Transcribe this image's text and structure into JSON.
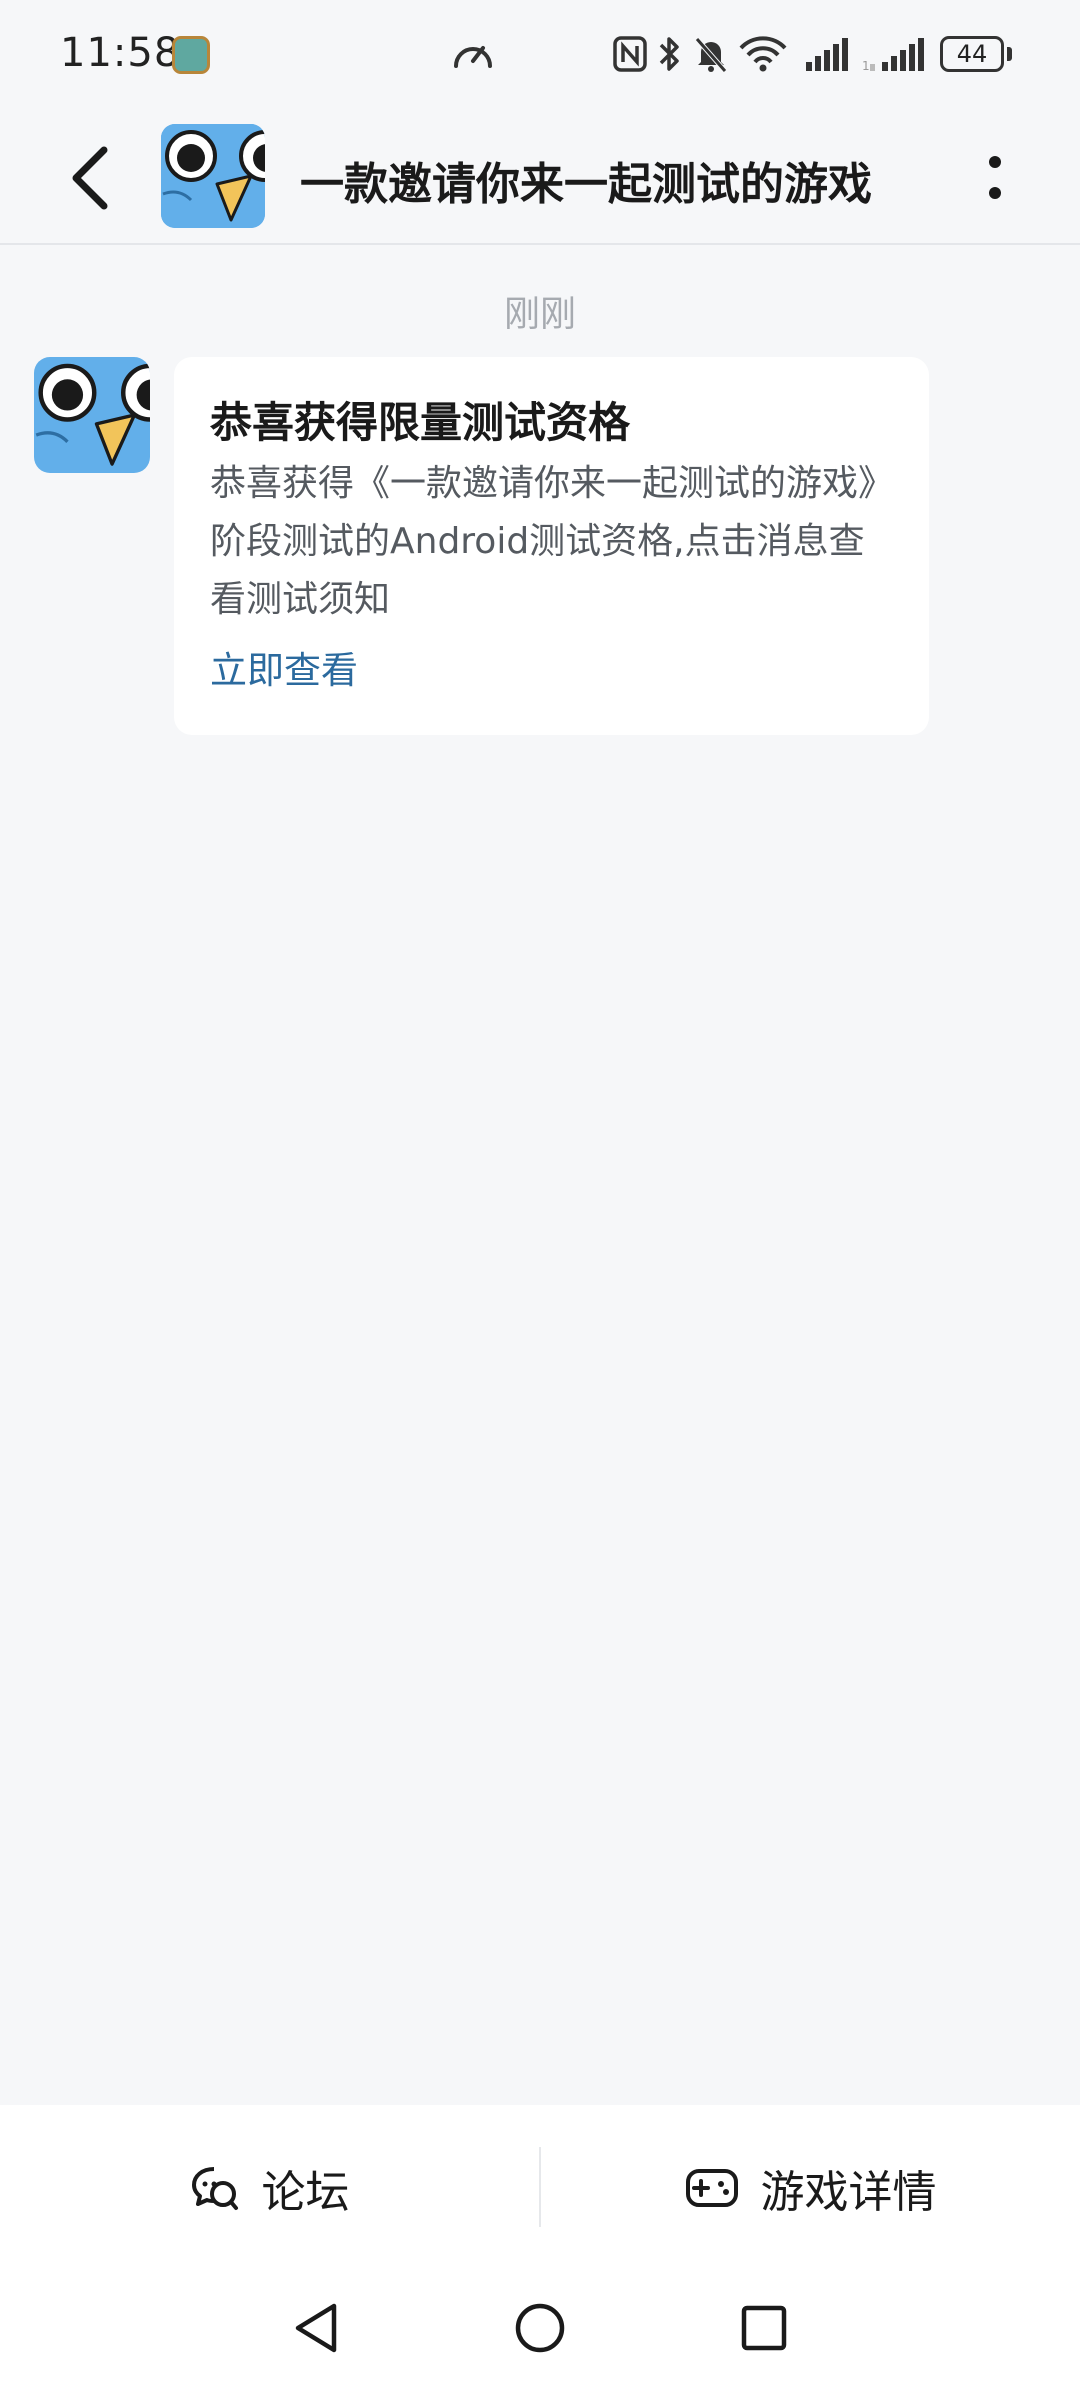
{
  "status_bar": {
    "time": "11:58",
    "battery": "44",
    "icons": [
      "speed-icon",
      "nfc-icon",
      "bluetooth-icon",
      "mute-icon",
      "wifi-icon",
      "signal-icon",
      "signal-icon"
    ]
  },
  "header": {
    "title": "一款邀请你来一起测试的游戏",
    "back_icon": "back-icon",
    "more_icon": "more-icon"
  },
  "messages": {
    "timestamp": "刚刚",
    "items": [
      {
        "title": "恭喜获得限量测试资格",
        "body": "恭喜获得《一款邀请你来一起测试的游戏》阶段测试的Android测试资格,点击消息查看测试须知",
        "link": "立即查看"
      }
    ]
  },
  "bottom_bar": {
    "forum_label": "论坛",
    "game_detail_label": "游戏详情"
  },
  "colors": {
    "background": "#f6f7f9",
    "card": "#ffffff",
    "link": "#2b6a9e",
    "timestamp": "#a6aab0",
    "avatar_blue": "#5aa7e6"
  }
}
